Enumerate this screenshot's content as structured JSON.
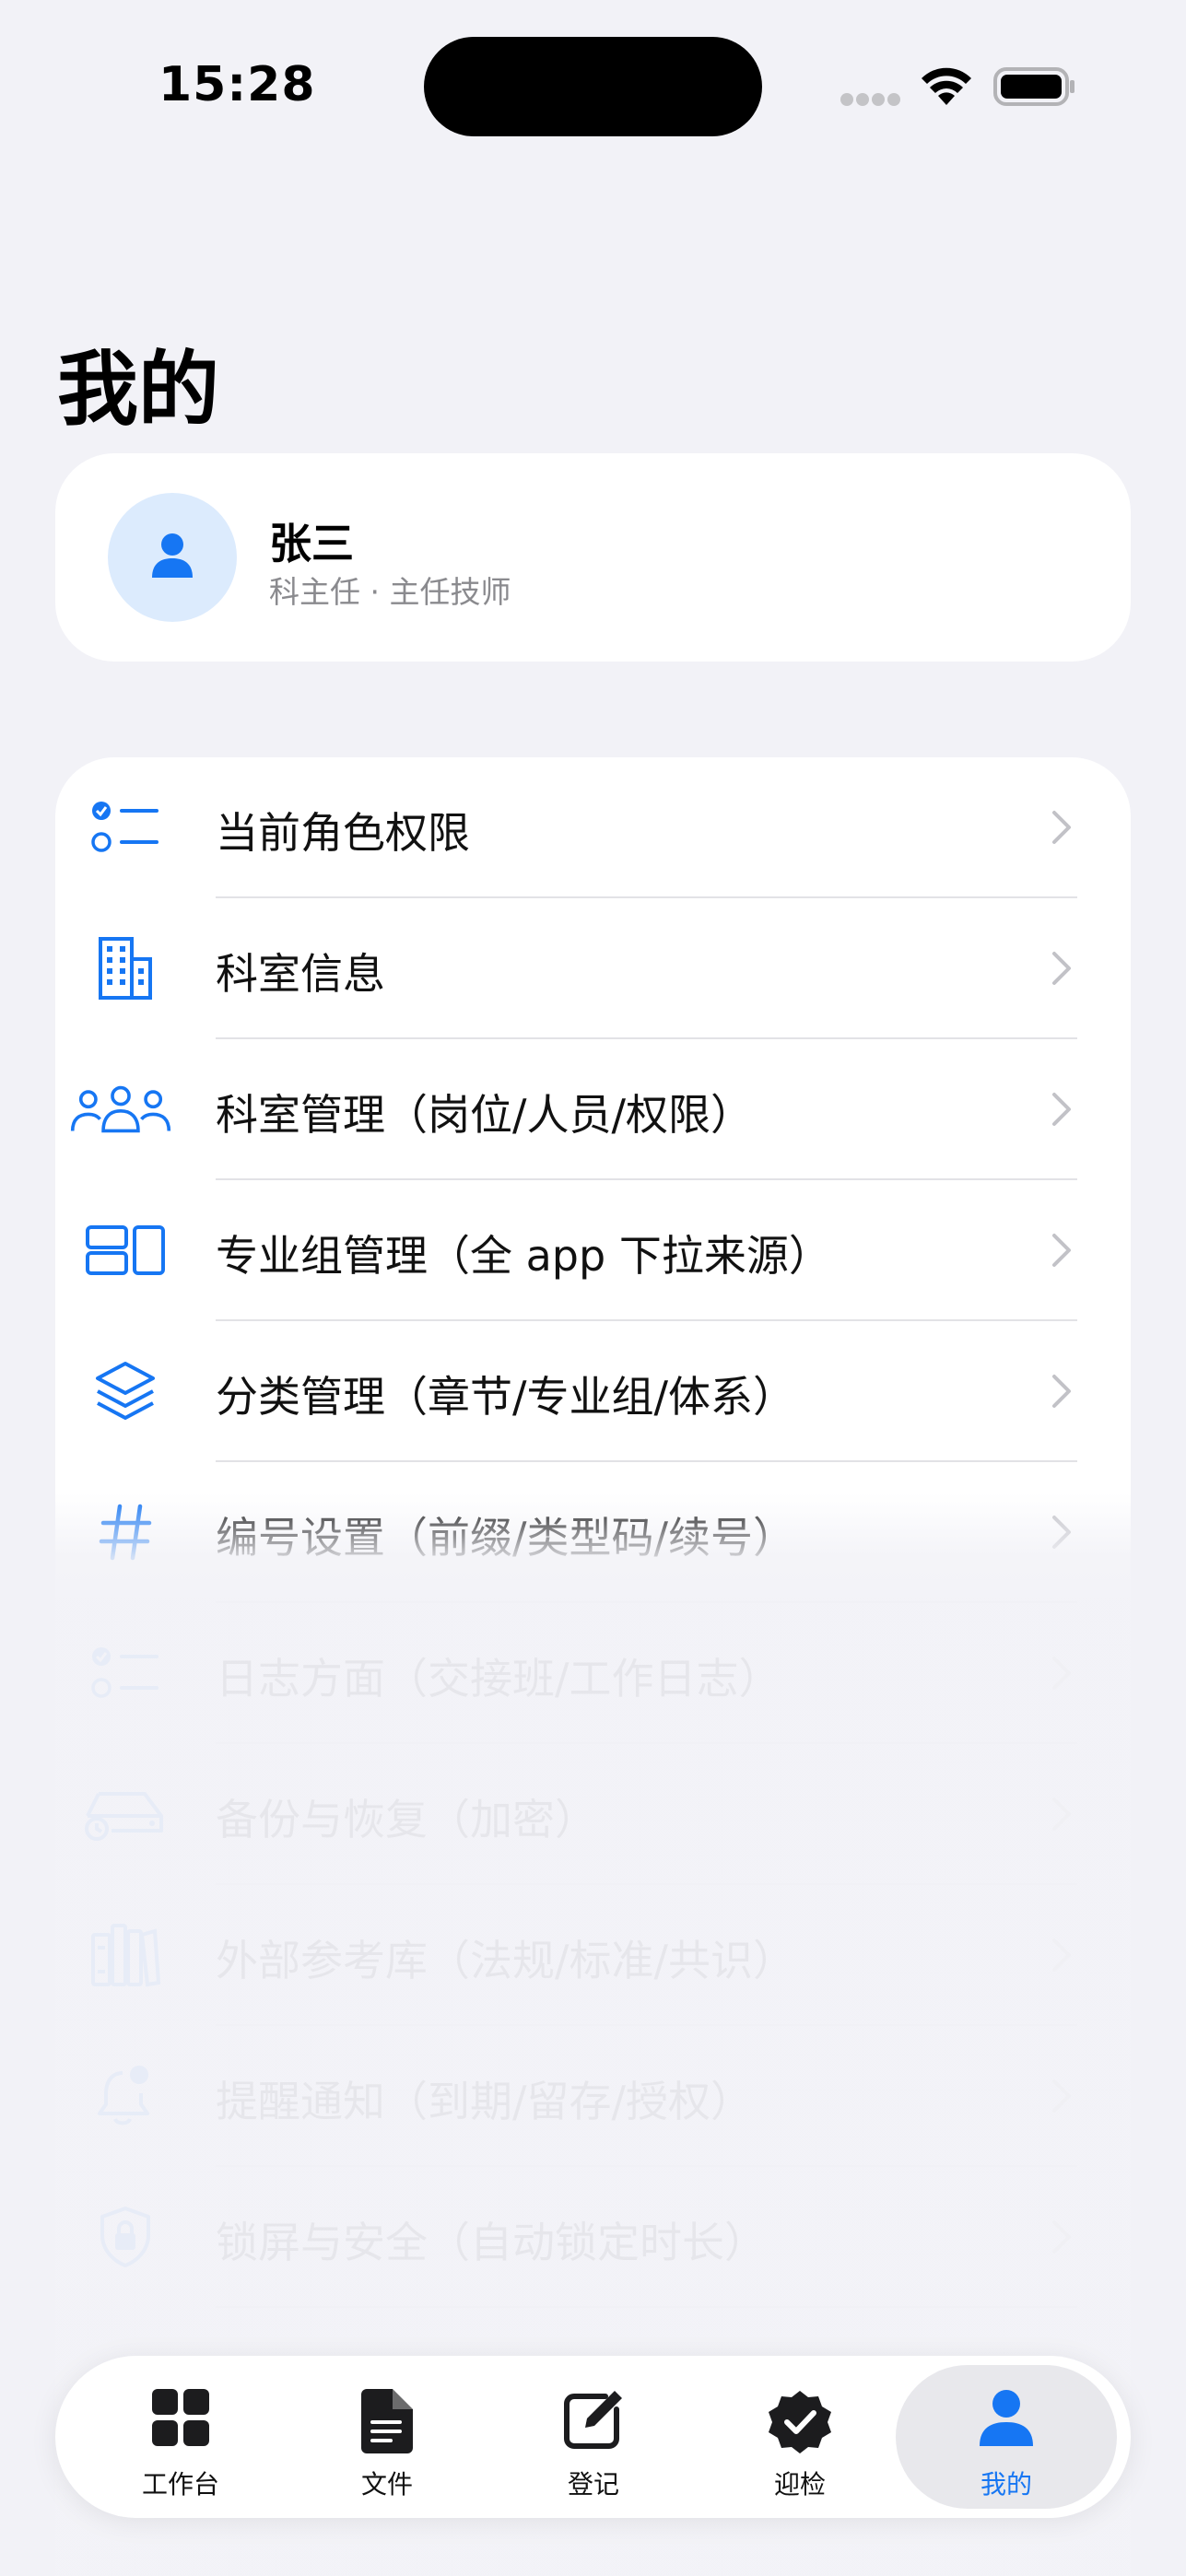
{
  "status_bar": {
    "time": "15:28"
  },
  "page_title": "我的",
  "profile": {
    "name": "张三",
    "subtitle": "科主任 · 主任技师"
  },
  "menu": [
    {
      "label": "当前角色权限",
      "icon": "checklist-icon"
    },
    {
      "label": "科室信息",
      "icon": "building-icon"
    },
    {
      "label": "科室管理（岗位/人员/权限）",
      "icon": "people-group-icon"
    },
    {
      "label": "专业组管理（全 app 下拉来源）",
      "icon": "layout-blocks-icon"
    },
    {
      "label": "分类管理（章节/专业组/体系）",
      "icon": "layers-icon"
    },
    {
      "label": "编号设置（前缀/类型码/续号）",
      "icon": "number-sign-icon"
    },
    {
      "label": "日志方面（交接班/工作日志）",
      "icon": "checklist-icon"
    },
    {
      "label": "备份与恢复（加密）",
      "icon": "drive-restore-icon"
    },
    {
      "label": "外部参考库（法规/标准/共识）",
      "icon": "books-icon"
    },
    {
      "label": "提醒通知（到期/留存/授权）",
      "icon": "bell-badge-icon"
    },
    {
      "label": "锁屏与安全（自动锁定时长）",
      "icon": "lock-shield-icon"
    }
  ],
  "tabs": [
    {
      "label": "工作台",
      "icon": "grid-icon",
      "active": false
    },
    {
      "label": "文件",
      "icon": "document-icon",
      "active": false
    },
    {
      "label": "登记",
      "icon": "edit-icon",
      "active": false
    },
    {
      "label": "迎检",
      "icon": "verified-badge-icon",
      "active": false
    },
    {
      "label": "我的",
      "icon": "person-icon",
      "active": true
    }
  ],
  "colors": {
    "accent": "#1676f3",
    "background": "#f2f2f7",
    "card": "#ffffff",
    "avatar_bg": "#dcebfd"
  }
}
